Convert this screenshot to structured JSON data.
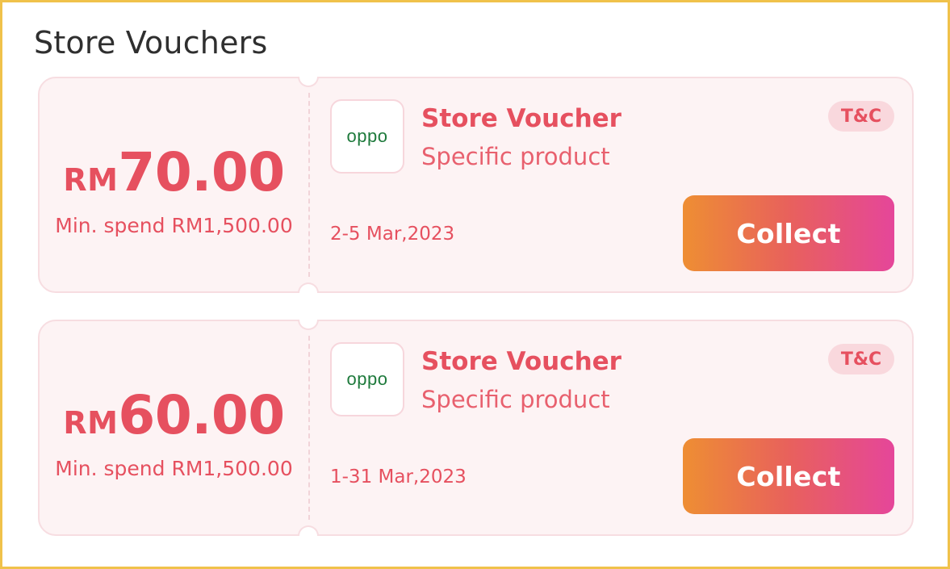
{
  "section": {
    "title": "Store Vouchers"
  },
  "vouchers": [
    {
      "currency": "RM",
      "amount": "70.00",
      "min_spend": "Min. spend RM1,500.00",
      "brand": "oppo",
      "title": "Store Voucher",
      "subtitle": "Specific product",
      "tc_label": "T&C",
      "date": "2-5 Mar,2023",
      "collect_label": "Collect"
    },
    {
      "currency": "RM",
      "amount": "60.00",
      "min_spend": "Min. spend RM1,500.00",
      "brand": "oppo",
      "title": "Store Voucher",
      "subtitle": "Specific product",
      "tc_label": "T&C",
      "date": "1-31 Mar,2023",
      "collect_label": "Collect"
    }
  ],
  "colors": {
    "frame_border": "#f0c24b",
    "accent": "#e6505f",
    "card_bg": "#fdf3f4",
    "brand_green": "#1e7a3c",
    "button_gradient": [
      "#ee8e33",
      "#e8615c",
      "#e5469a"
    ]
  }
}
